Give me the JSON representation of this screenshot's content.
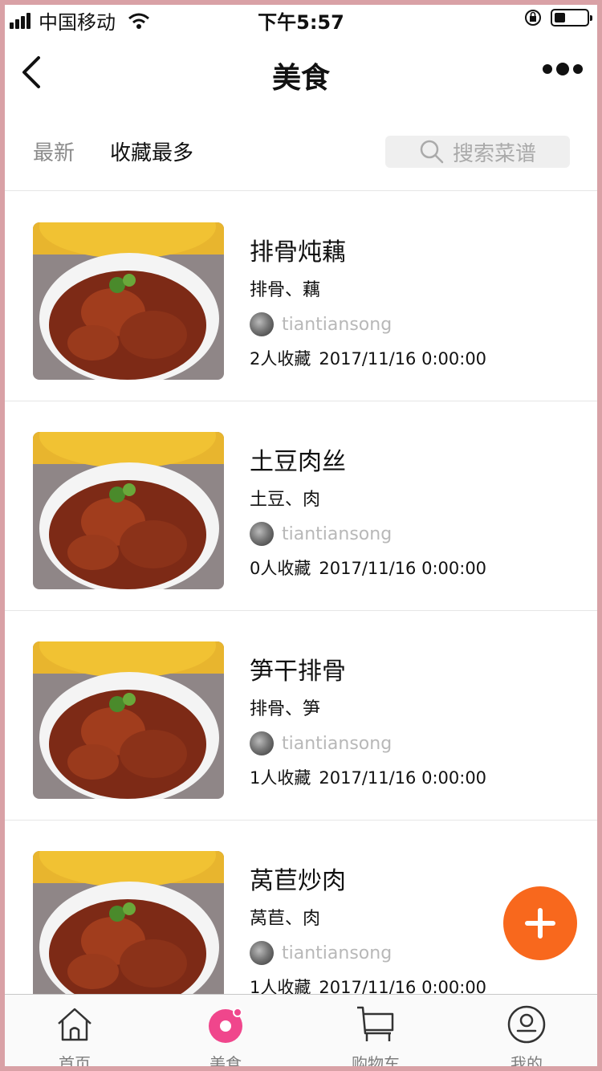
{
  "status_bar": {
    "carrier": "中国移动",
    "time": "下午5:57",
    "battery_level": 0.35
  },
  "nav": {
    "title": "美食"
  },
  "tabs": {
    "latest": "最新",
    "most_favorited": "收藏最多",
    "active": "收藏最多"
  },
  "search": {
    "placeholder": "搜索菜谱"
  },
  "recipes": [
    {
      "title": "排骨炖藕",
      "ingredients": "排骨、藕",
      "author": "tiantiansong",
      "favorites": "2人收藏",
      "date": "2017/11/16 0:00:00"
    },
    {
      "title": "土豆肉丝",
      "ingredients": "土豆、肉",
      "author": "tiantiansong",
      "favorites": "0人收藏",
      "date": "2017/11/16 0:00:00"
    },
    {
      "title": "笋干排骨",
      "ingredients": "排骨、笋",
      "author": "tiantiansong",
      "favorites": "1人收藏",
      "date": "2017/11/16 0:00:00"
    },
    {
      "title": "莴苣炒肉",
      "ingredients": "莴苣、肉",
      "author": "tiantiansong",
      "favorites": "1人收藏",
      "date": "2017/11/16 0:00:00"
    }
  ],
  "tabbar": {
    "items": [
      {
        "label": "首页",
        "icon": "home-icon"
      },
      {
        "label": "美食",
        "icon": "donut-icon"
      },
      {
        "label": "购物车",
        "icon": "cart-icon"
      },
      {
        "label": "我的",
        "icon": "profile-icon"
      }
    ],
    "active": "美食"
  },
  "colors": {
    "accent": "#f8681d",
    "active_tab_icon": "#f0468c",
    "muted_text": "#8a8a8a",
    "author_text": "#b8b8b8"
  }
}
